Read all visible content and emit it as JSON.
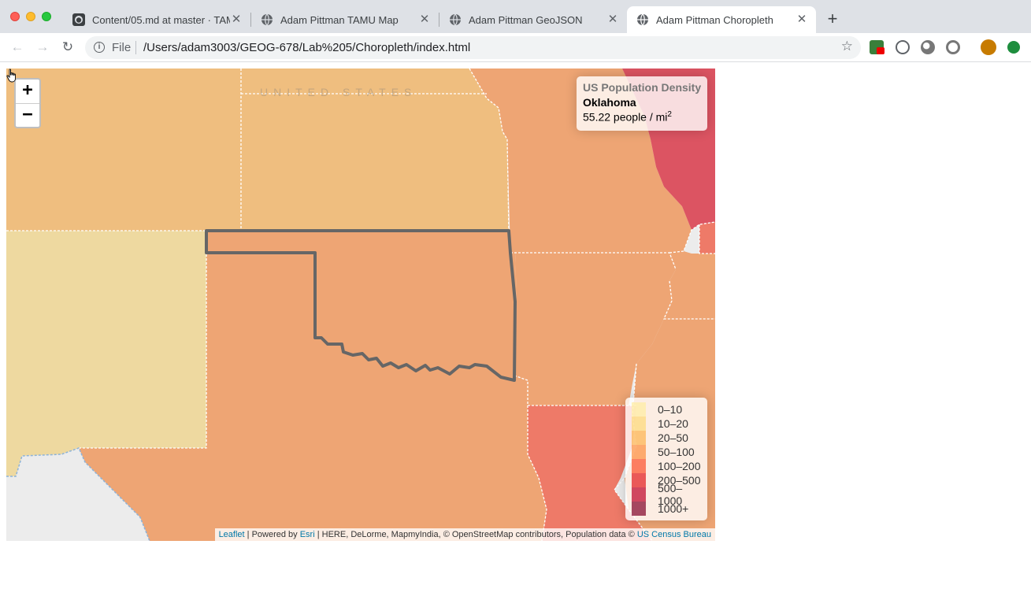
{
  "browser": {
    "tabs": [
      {
        "title": "Content/05.md at master · TAMU",
        "icon": "github-icon",
        "active": false
      },
      {
        "title": "Adam Pittman TAMU Map",
        "icon": "globe-icon",
        "active": false
      },
      {
        "title": "Adam Pittman GeoJSON",
        "icon": "globe-icon",
        "active": false
      },
      {
        "title": "Adam Pittman Choropleth",
        "icon": "globe-icon",
        "active": true
      }
    ],
    "new_tab_label": "+",
    "address": {
      "scheme_label": "File",
      "url": "/Users/adam3003/GEOG-678/Lab%205/Choropleth/index.html"
    }
  },
  "map": {
    "zoom_in_label": "+",
    "zoom_out_label": "−",
    "country_label": "UNITED STATES",
    "info": {
      "title": "US Population Density",
      "state_name": "Oklahoma",
      "value_text": "55.22 people / mi",
      "value_sup": "2"
    },
    "legend": [
      {
        "label": "0–10",
        "color": "#ffeda0"
      },
      {
        "label": "10–20",
        "color": "#fed976"
      },
      {
        "label": "20–50",
        "color": "#feb24c"
      },
      {
        "label": "50–100",
        "color": "#fd8d3c"
      },
      {
        "label": "100–200",
        "color": "#fc4e2a"
      },
      {
        "label": "200–500",
        "color": "#e31a1c"
      },
      {
        "label": "500–1000",
        "color": "#bd0026"
      },
      {
        "label": "1000+",
        "color": "#800026"
      }
    ],
    "attribution": {
      "leaflet": "Leaflet",
      "sep1": " | Powered by ",
      "esri": "Esri",
      "rest": " | HERE, DeLorme, MapmyIndia, © OpenStreetMap contributors, Population data © ",
      "census": "US Census Bureau"
    },
    "colors": {
      "tier_20_50": "#efbe7f",
      "tier_10_20": "#eed9a0",
      "tier_50_100": "#eea574",
      "tier_100_200": "#ee7a68",
      "tier_200_500": "#dc5462",
      "highlight_border": "#666666",
      "state_border": "#ffffff",
      "water": "#ececec"
    }
  }
}
